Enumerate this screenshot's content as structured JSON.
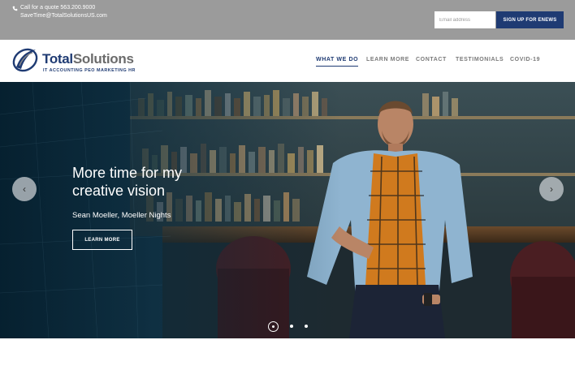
{
  "topbar": {
    "phone_text": "Call for a quote 563.200.9000",
    "email_text": "SaveTime@TotalSolutionsUS.com",
    "email_placeholder": "Email address",
    "signup_label": "SIGN UP FOR ENEWS"
  },
  "logo": {
    "brand_primary": "Total",
    "brand_secondary": "Solutions",
    "tagline": "IT  ACCOUNTING  PEO  MARKETING  HR"
  },
  "nav": {
    "items": [
      {
        "label": "WHAT WE DO",
        "active": true
      },
      {
        "label": "LEARN MORE",
        "active": false
      },
      {
        "label": "CONTACT",
        "active": false
      },
      {
        "label": "TESTIMONIALS",
        "active": false
      },
      {
        "label": "COVID-19",
        "active": false
      }
    ]
  },
  "hero": {
    "headline": "More time for my creative vision",
    "byline": "Sean Moeller, Moeller Nights",
    "button_label": "LEARN MORE",
    "prev_arrow": "‹",
    "next_arrow": "›",
    "slide_count": 3,
    "active_slide": 1
  },
  "colors": {
    "brand_navy": "#1f3b73",
    "topbar_gray": "#9b9b9b",
    "nav_gray": "#7a7a7a"
  }
}
